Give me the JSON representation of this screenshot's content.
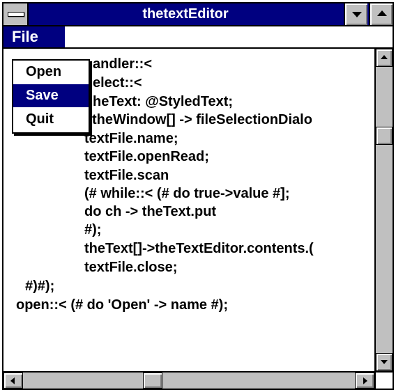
{
  "window": {
    "title": "thetextEditor"
  },
  "menubar": {
    "file_label": "File"
  },
  "file_menu": {
    "items": [
      {
        "label": "Open"
      },
      {
        "label": "Save",
        "selected": true
      },
      {
        "label": "Quit"
      }
    ]
  },
  "editor": {
    "lines": [
      {
        "text": "andler::<"
      },
      {
        "text": "elect::<"
      },
      {
        "text": "heText: @StyledText;"
      },
      {
        "text": "do theWindow[] -> fileSelectionDialo"
      },
      {
        "text": "textFile.name;"
      },
      {
        "text": "textFile.openRead;"
      },
      {
        "text": "textFile.scan"
      },
      {
        "text": "(# while::< (# do true->value #];"
      },
      {
        "text": "do ch -> theText.put"
      },
      {
        "text": "#);"
      },
      {
        "text": "theText[]->theTextEditor.contents.("
      },
      {
        "text": "textFile.close;"
      },
      {
        "text": "#)#);"
      },
      {
        "text": "open::< (# do 'Open' -> name #);"
      }
    ]
  },
  "colors": {
    "title_bar": "#000080",
    "selection": "#000080",
    "chrome": "#c0c0c0",
    "background": "#ffffff"
  },
  "icons": {
    "system_menu": "system-menu-icon",
    "minimize": "minimize-icon",
    "maximize": "maximize-icon",
    "scroll_up": "scroll-up-arrow-icon",
    "scroll_down": "scroll-down-arrow-icon",
    "scroll_left": "scroll-left-arrow-icon",
    "scroll_right": "scroll-right-arrow-icon"
  }
}
